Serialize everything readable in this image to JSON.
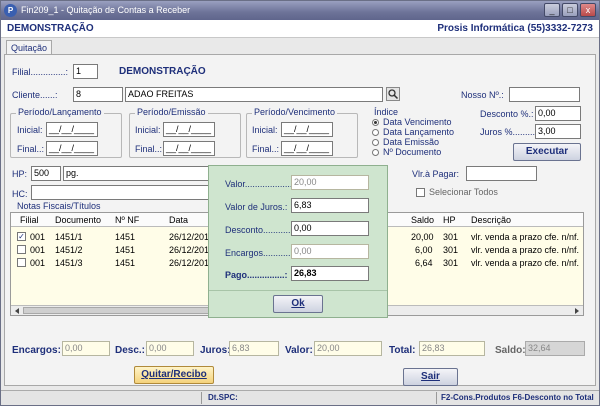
{
  "window": {
    "title": "Fin209_1 - Quitação de Contas a Receber",
    "app_icon": "P",
    "controls": [
      "_",
      "□",
      "x"
    ]
  },
  "header": {
    "company": "DEMONSTRAÇÃO",
    "vendor": "Prosis Informática (55)3332-7273"
  },
  "tabs": [
    {
      "label": "Quitação"
    }
  ],
  "form": {
    "filial_label": "Filial..............:",
    "filial_value": "1",
    "filial_name": "DEMONSTRAÇÃO",
    "cliente_label": "Cliente......:",
    "cliente_code": "8",
    "cliente_name": "ADAO FREITAS",
    "nosso_label": "Nosso Nº.:",
    "nosso_value": "",
    "desconto_pct_label": "Desconto %.:",
    "desconto_pct_value": "0,00",
    "juros_pct_label": "Juros %.........:",
    "juros_pct_value": "3,00",
    "executar_label": "Executar",
    "hp_label": "HP:",
    "hp_value": "500",
    "hp_desc": "pg.",
    "hc_label": "HC:",
    "hc_value": "",
    "vlr_pagar_label": "Vlr.à Pagar:",
    "vlr_pagar_value": "",
    "selecionar_todos": "Selecionar Todos"
  },
  "periods": [
    {
      "caption": "Período/Lançamento",
      "inicial_label": "Inicial:",
      "inicial_value": "__/__/____",
      "final_label": "Final..:",
      "final_value": "__/__/____"
    },
    {
      "caption": "Período/Emissão",
      "inicial_label": "Inicial:",
      "inicial_value": "__/__/____",
      "final_label": "Final..:",
      "final_value": "__/__/____"
    },
    {
      "caption": "Período/Vencimento",
      "inicial_label": "Inicial:",
      "inicial_value": "__/__/____",
      "final_label": "Final..:",
      "final_value": "__/__/____"
    }
  ],
  "indice": {
    "caption": "Índice",
    "options": [
      {
        "label": "Data Vencimento",
        "selected": true
      },
      {
        "label": "Data Lançamento",
        "selected": false
      },
      {
        "label": "Data Emissão",
        "selected": false
      },
      {
        "label": "Nº Documento",
        "selected": false
      }
    ]
  },
  "table": {
    "caption": "Notas Fiscais/Títulos",
    "headers": {
      "filial": "Filial",
      "documento": "Documento",
      "nnf": "Nº NF",
      "data": "Data",
      "saldo": "Saldo",
      "hp": "HP",
      "descricao": "Descrição"
    },
    "rows": [
      {
        "checked": true,
        "filial": "001",
        "documento": "1451/1",
        "nnf": "1451",
        "data": "26/12/201",
        "saldo": "20,00",
        "hp": "301",
        "descricao": "vlr. venda a prazo cfe. n/nf."
      },
      {
        "checked": false,
        "filial": "001",
        "documento": "1451/2",
        "nnf": "1451",
        "data": "26/12/201",
        "saldo": "6,00",
        "hp": "301",
        "descricao": "vlr. venda a prazo cfe. n/nf."
      },
      {
        "checked": false,
        "filial": "001",
        "documento": "1451/3",
        "nnf": "1451",
        "data": "26/12/201",
        "saldo": "6,64",
        "hp": "301",
        "descricao": "vlr. venda a prazo cfe. n/nf."
      }
    ]
  },
  "modal": {
    "valor_label": "Valor.....................:",
    "valor_value": "20,00",
    "juros_label": "Valor de Juros.:",
    "juros_value": "6,83",
    "desconto_label": "Desconto............:",
    "desconto_value": "0,00",
    "encargos_label": "Encargos...........:",
    "encargos_value": "0,00",
    "pago_label": "Pago...............:",
    "pago_value": "26,83",
    "ok_label": "Ok"
  },
  "totals": {
    "encargos_label": "Encargos:",
    "encargos_value": "0,00",
    "desc_label": "Desc.:",
    "desc_value": "0,00",
    "juros_label": "Juros:",
    "juros_value": "6,83",
    "valor_label": "Valor:",
    "valor_value": "20,00",
    "total_label": "Total:",
    "total_value": "26,83",
    "saldo_label": "Saldo:",
    "saldo_value": "32,64"
  },
  "actions": {
    "quitar_label": "Quitar/Recibo",
    "sair_label": "Sair"
  },
  "statusbar": {
    "dtspc": "Dt.SPC:",
    "shortcuts": "F2-Cons.Produtos F6-Desconto no Total"
  }
}
